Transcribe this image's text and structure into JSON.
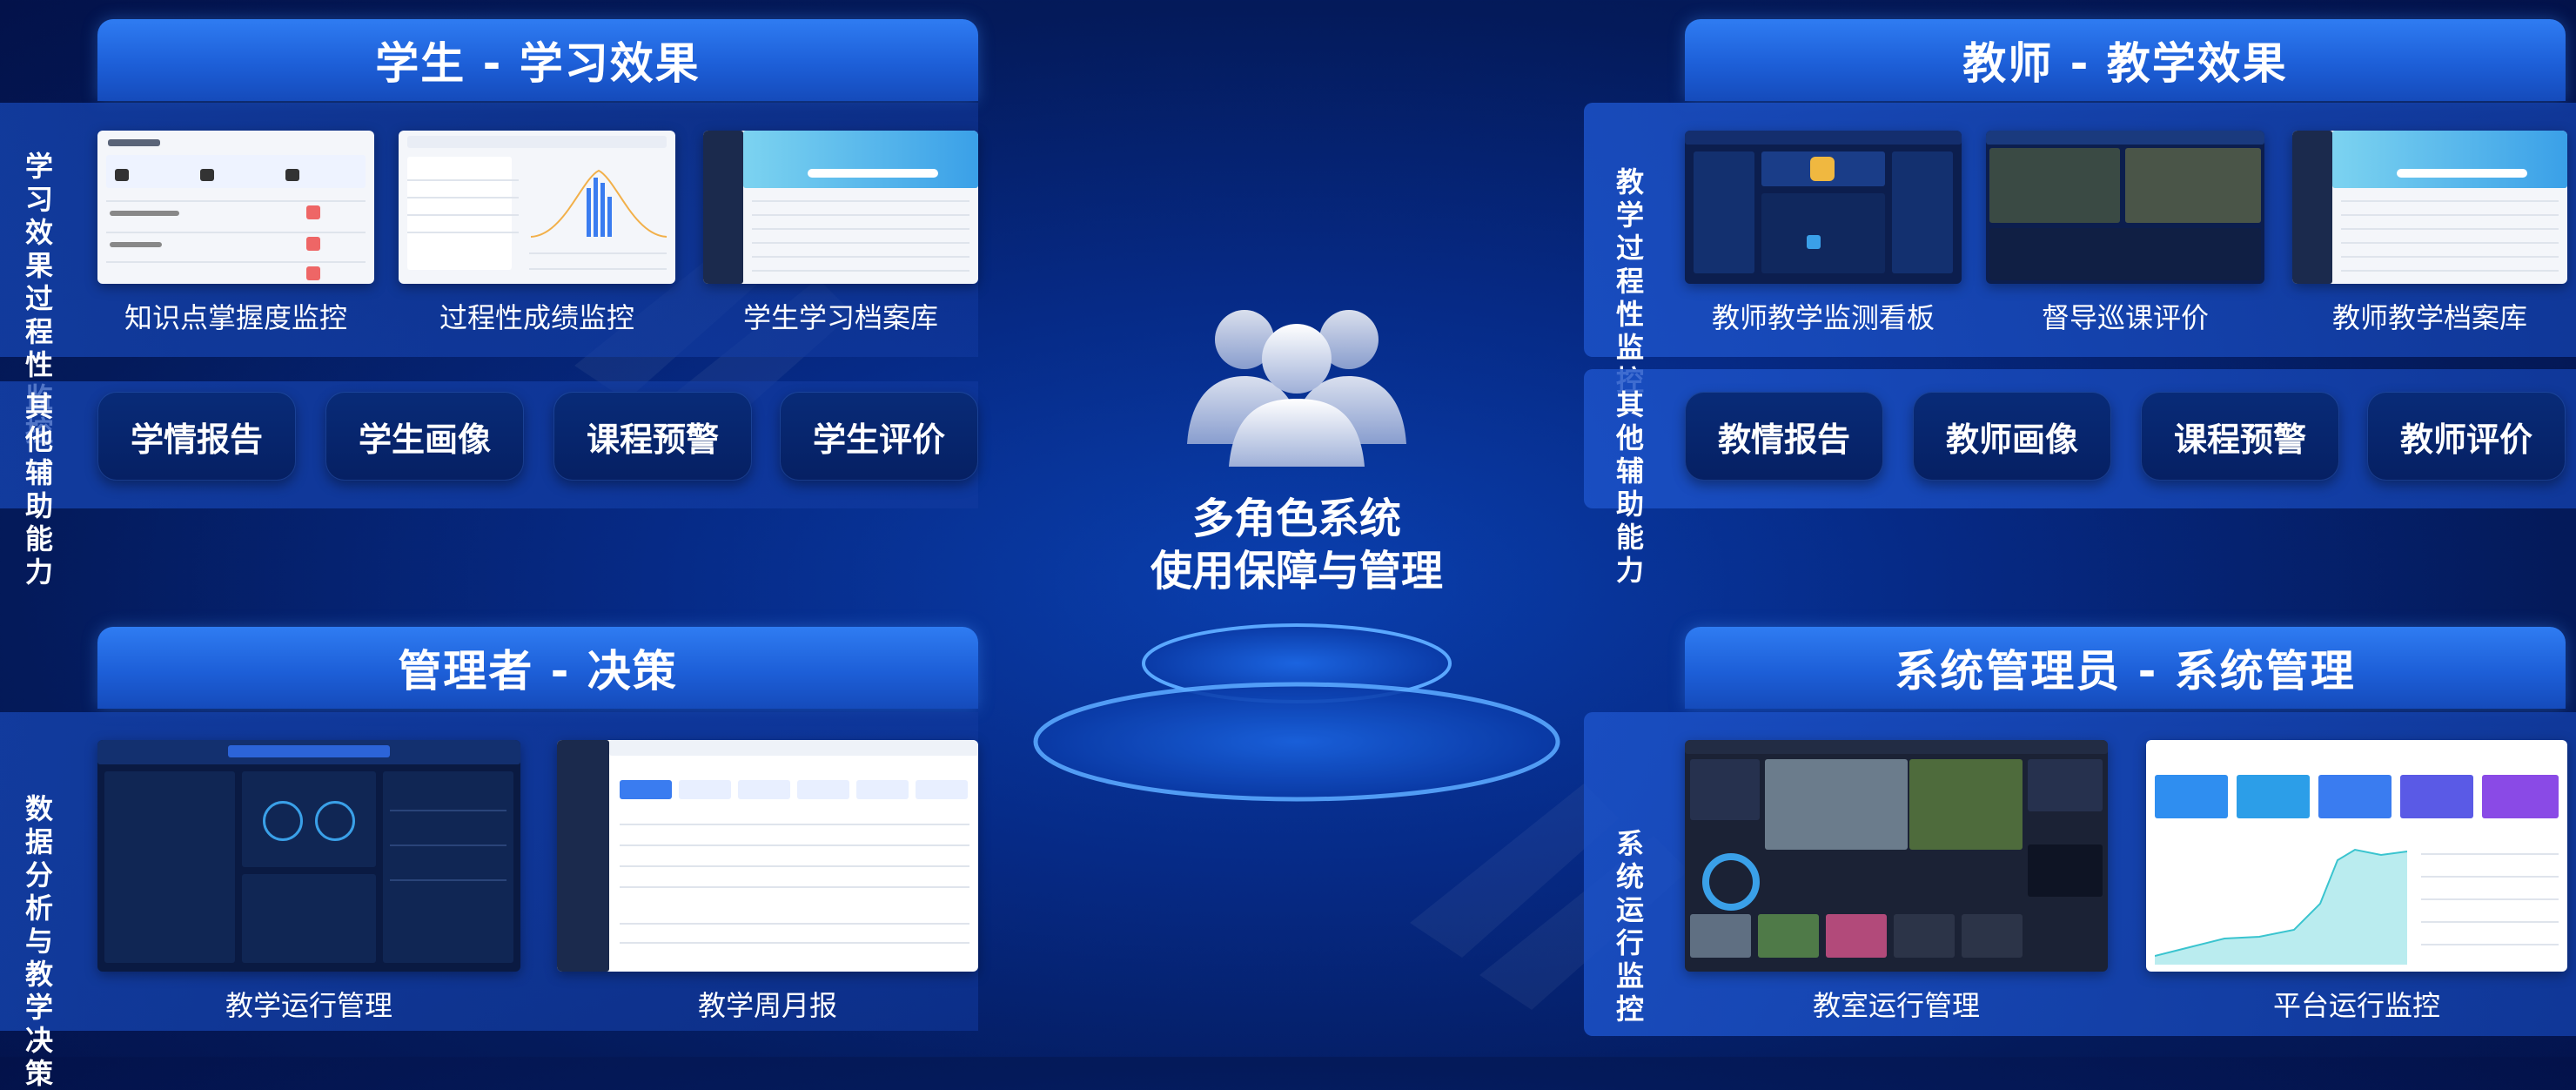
{
  "center": {
    "title_line1": "多角色系统",
    "title_line2": "使用保障与管理",
    "icon": "users-group-icon"
  },
  "student": {
    "header": "学生 - 学习效果",
    "process_label": "学习效果过程性监控",
    "other_label": "其他辅助能力",
    "thumbnails": [
      {
        "caption": "知识点掌握度监控"
      },
      {
        "caption": "过程性成绩监控"
      },
      {
        "caption": "学生学习档案库"
      }
    ],
    "buttons": [
      "学情报告",
      "学生画像",
      "课程预警",
      "学生评价"
    ]
  },
  "teacher": {
    "header": "教师 - 教学效果",
    "process_label": "教学过程性监控",
    "other_label": "其他辅助能力",
    "thumbnails": [
      {
        "caption": "教师教学监测看板"
      },
      {
        "caption": "督导巡课评价"
      },
      {
        "caption": "教师教学档案库"
      }
    ],
    "buttons": [
      "教情报告",
      "教师画像",
      "课程预警",
      "教师评价"
    ]
  },
  "manager": {
    "header": "管理者 - 决策",
    "side_label": "数据分析与教学决策",
    "thumbnails": [
      {
        "caption": "教学运行管理"
      },
      {
        "caption": "教学周月报"
      }
    ]
  },
  "admin": {
    "header": "系统管理员 - 系统管理",
    "side_label": "系统运行监控",
    "thumbnails": [
      {
        "caption": "教室运行管理"
      },
      {
        "caption": "平台运行监控"
      }
    ]
  },
  "colors": {
    "background": "#062a86",
    "header": "#2f7cf2",
    "pill": "#082b78"
  }
}
